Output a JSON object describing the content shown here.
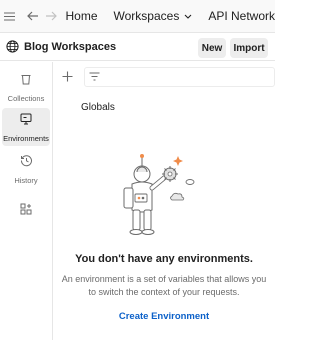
{
  "topbar": {
    "icons": [
      "hamburger-menu-icon",
      "back-arrow-icon",
      "forward-arrow-icon"
    ],
    "home_label": "Home",
    "workspaces_label": "Workspaces",
    "api_label": "API Network"
  },
  "workspace": {
    "name": "Blog Workspaces",
    "new_label": "New",
    "import_label": "Import"
  },
  "sidebar": {
    "items": [
      {
        "label": "Collections",
        "icon": "trash-can-icon",
        "active": false
      },
      {
        "label": "Environments",
        "icon": "environment-monitor-icon",
        "active": true
      },
      {
        "label": "History",
        "icon": "history-clock-icon",
        "active": false
      },
      {
        "label": "",
        "icon": "apps-grid-plus-icon",
        "active": false
      }
    ]
  },
  "main": {
    "globals_label": "Globals",
    "empty_title": "You don't have any environments.",
    "empty_description": "An environment is a set of variables that allows you to switch the context of your requests.",
    "create_link": "Create Environment"
  },
  "colors": {
    "accent_link": "#0c61c9",
    "active_bg": "#ededed",
    "illustration_orange": "#f08c4a"
  }
}
